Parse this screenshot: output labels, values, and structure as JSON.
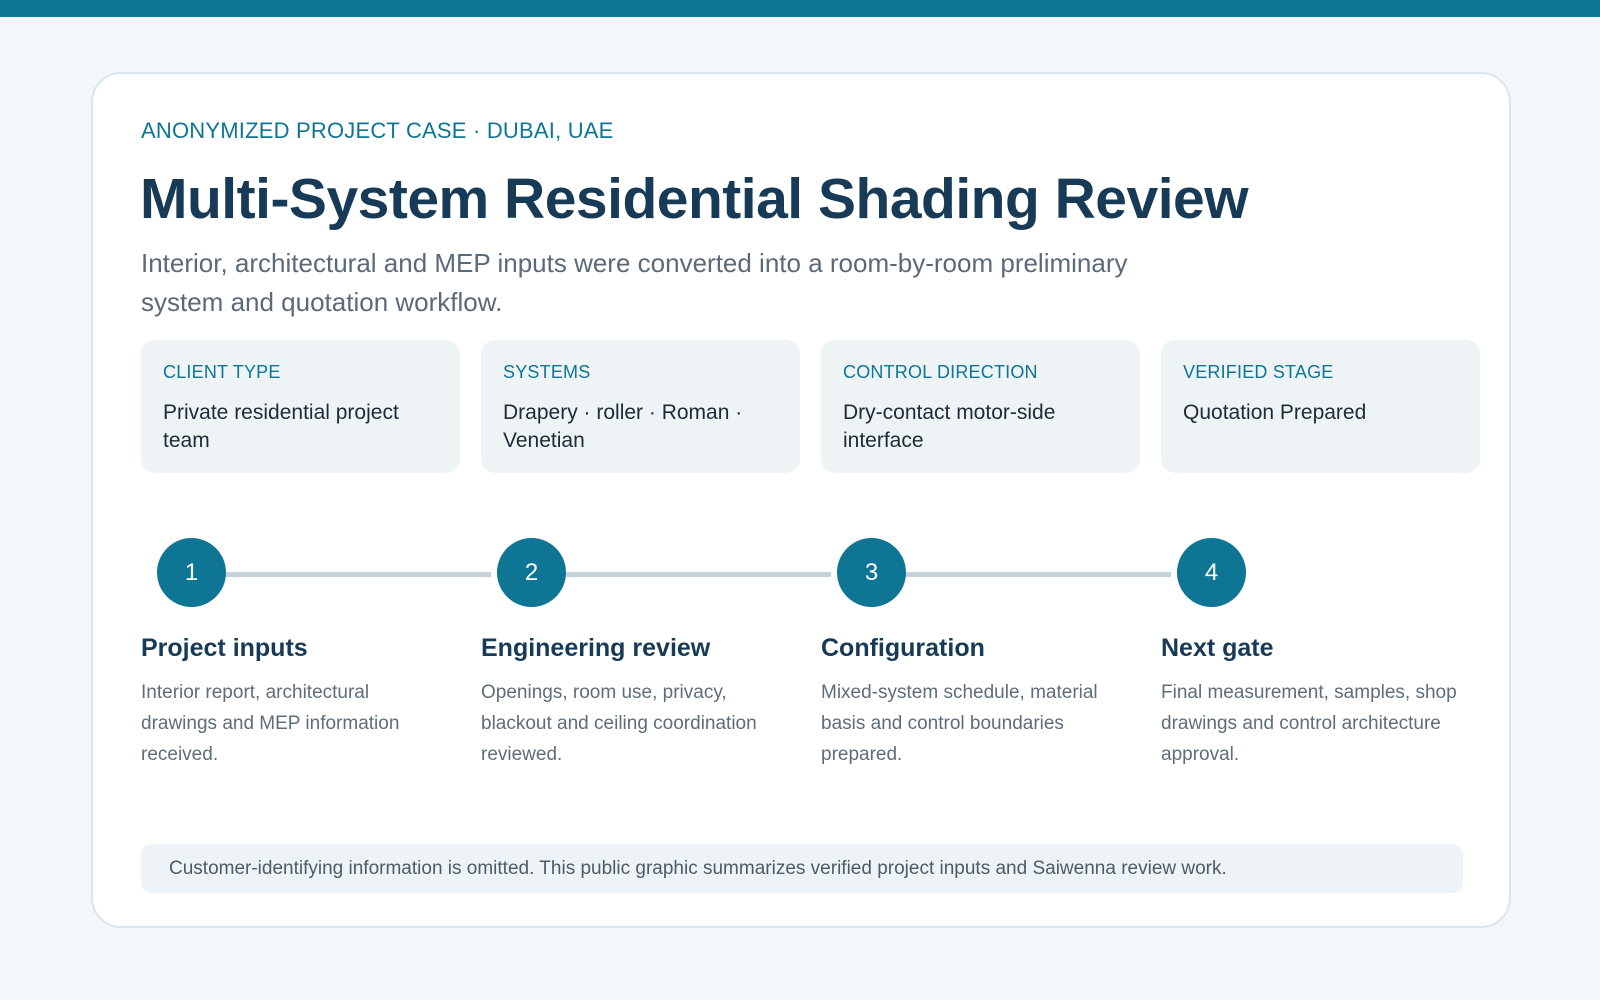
{
  "header": {
    "eyebrow": "ANONYMIZED PROJECT CASE · DUBAI, UAE",
    "title": "Multi-System Residential Shading Review",
    "subtitle": "Interior, architectural and MEP inputs were converted into a room-by-room preliminary system and quotation workflow."
  },
  "facts": [
    {
      "label": "CLIENT TYPE",
      "value": "Private residential project team"
    },
    {
      "label": "SYSTEMS",
      "value": "Drapery · roller · Roman · Venetian"
    },
    {
      "label": "CONTROL DIRECTION",
      "value": "Dry-contact motor-side interface"
    },
    {
      "label": "VERIFIED STAGE",
      "value": "Quotation Prepared"
    }
  ],
  "steps": [
    {
      "number": "1",
      "title": "Project inputs",
      "description": "Interior report, architectural drawings and MEP information received."
    },
    {
      "number": "2",
      "title": "Engineering review",
      "description": "Openings, room use, privacy, blackout and ceiling coordination reviewed."
    },
    {
      "number": "3",
      "title": "Configuration",
      "description": "Mixed-system schedule, material basis and control boundaries prepared."
    },
    {
      "number": "4",
      "title": "Next gate",
      "description": "Final measurement, samples, shop drawings and control architecture approval."
    }
  ],
  "footer": {
    "note": "Customer-identifying information is omitted. This public graphic summarizes verified project inputs and Saiwenna review work."
  },
  "colors": {
    "accent": "#0e7694",
    "title": "#173a56",
    "background": "#f3f7f9"
  }
}
